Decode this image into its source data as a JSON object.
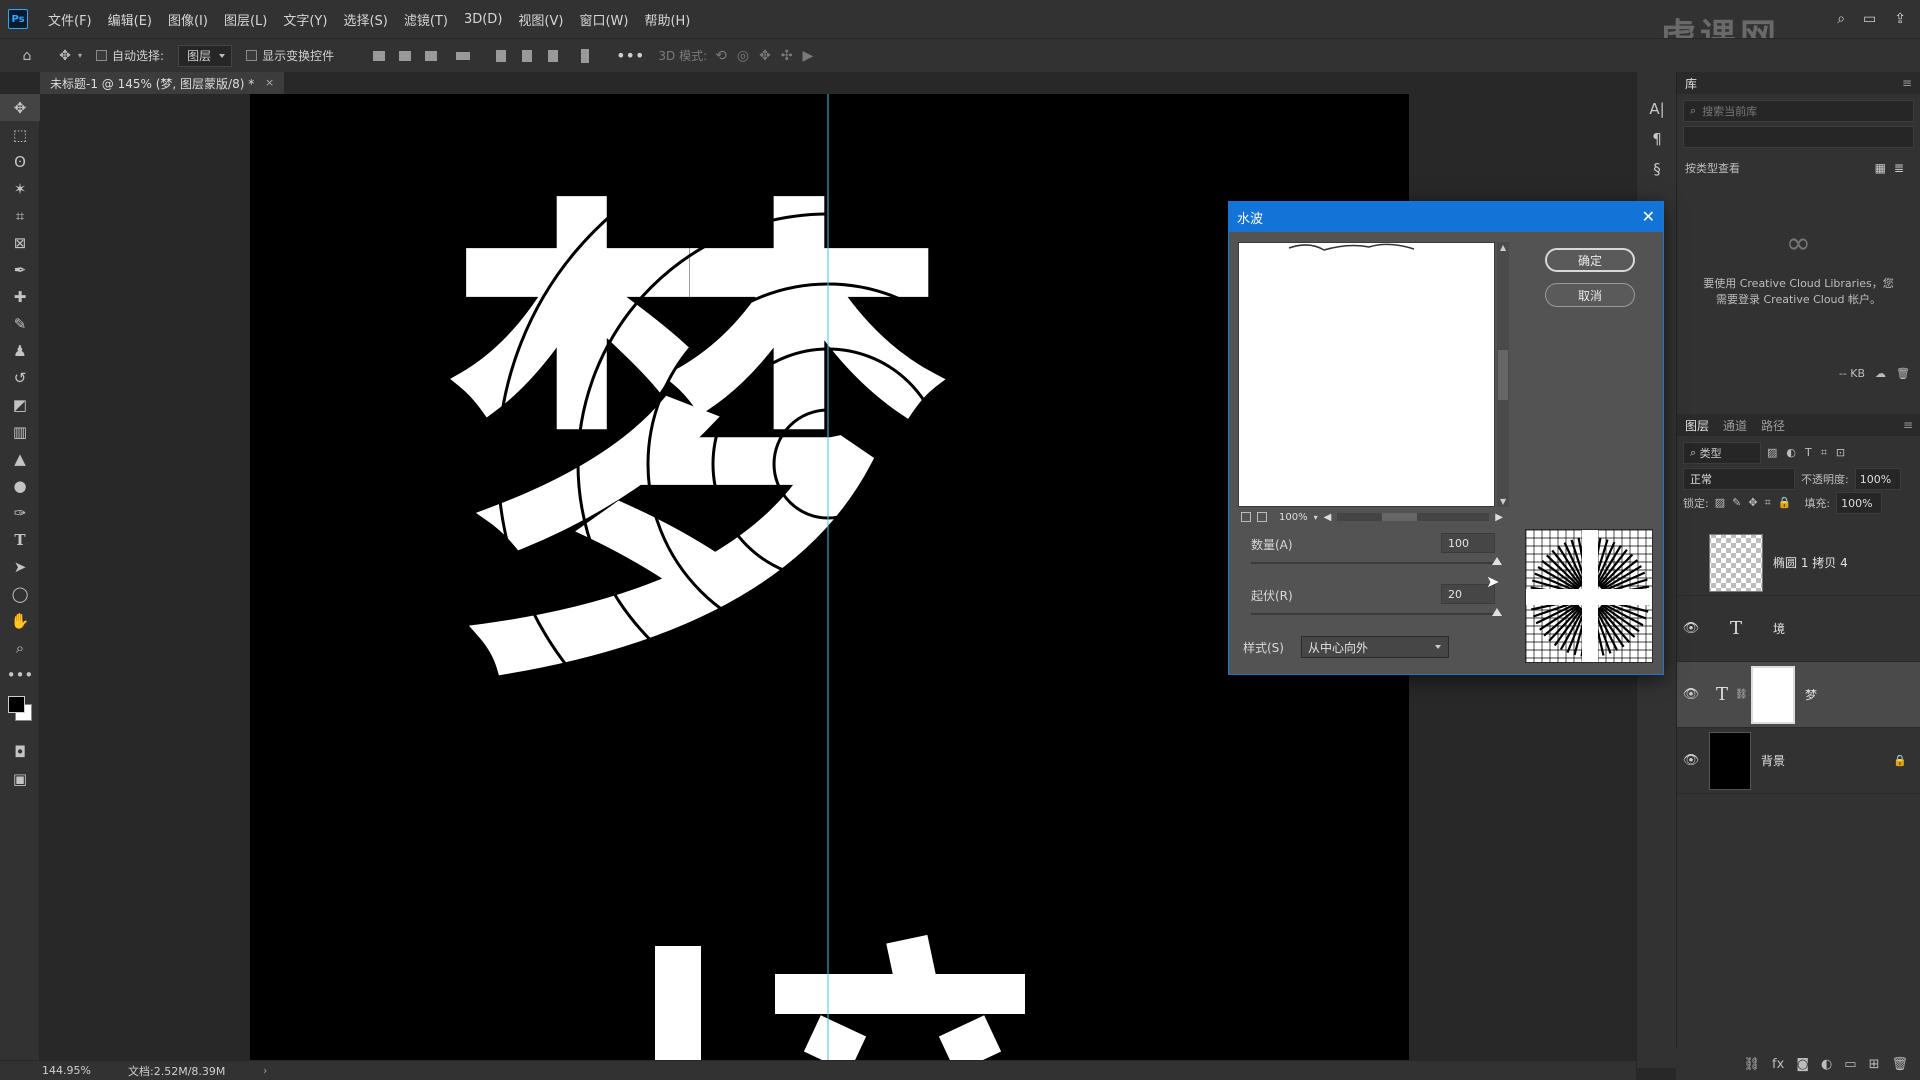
{
  "app": {
    "logo": "Ps"
  },
  "menu": [
    "文件(F)",
    "编辑(E)",
    "图像(I)",
    "图层(L)",
    "文字(Y)",
    "选择(S)",
    "滤镜(T)",
    "3D(D)",
    "视图(V)",
    "窗口(W)",
    "帮助(H)"
  ],
  "watermark": "虎课网",
  "options": {
    "auto_select_label": "自动选择:",
    "auto_select_value": "图层",
    "show_transform_label": "显示变换控件",
    "mode_3d_label": "3D 模式:"
  },
  "document": {
    "tab_title": "未标题-1 @ 145% (梦, 图层蒙版/8) *",
    "close": "×"
  },
  "canvas": {
    "glyph_main": "梦",
    "background_color": "#000000",
    "glyph_color": "#ffffff",
    "guide_color": "#48c6d8"
  },
  "status": {
    "zoom": "144.95%",
    "doc_info": "文档:2.52M/8.39M",
    "arrow": "›"
  },
  "dialog": {
    "title": "水波",
    "close": "✕",
    "ok": "确定",
    "cancel": "取消",
    "preview_zoom": "100%",
    "amount_label": "数量(A)",
    "amount_value": "100",
    "amount_level": 1.0,
    "ridges_label": "起伏(R)",
    "ridges_value": "20",
    "ridges_level": 1.0,
    "style_label": "样式(S)",
    "style_value": "从中心向外"
  },
  "library": {
    "tab": "库",
    "search_placeholder": "搜索当前库",
    "view_by": "按类型查看",
    "cc_message_line1": "要使用 Creative Cloud Libraries，您",
    "cc_message_line2": "需要登录 Creative Cloud 帐户。",
    "size": "-- KB"
  },
  "layers_panel": {
    "tabs": [
      "图层",
      "通道",
      "路径"
    ],
    "filter_kind": "类型",
    "blend_mode": "正常",
    "opacity_label": "不透明度:",
    "opacity_value": "100%",
    "lock_label": "锁定:",
    "fill_label": "填充:",
    "fill_value": "100%",
    "layers": [
      {
        "name": "椭圆 1 拷贝 4",
        "type": "shape",
        "visible": false
      },
      {
        "name": "境",
        "type": "text",
        "visible": true
      },
      {
        "name": "梦",
        "type": "text-masked",
        "visible": true,
        "selected": true
      },
      {
        "name": "背景",
        "type": "background",
        "visible": true,
        "locked": true
      }
    ]
  }
}
